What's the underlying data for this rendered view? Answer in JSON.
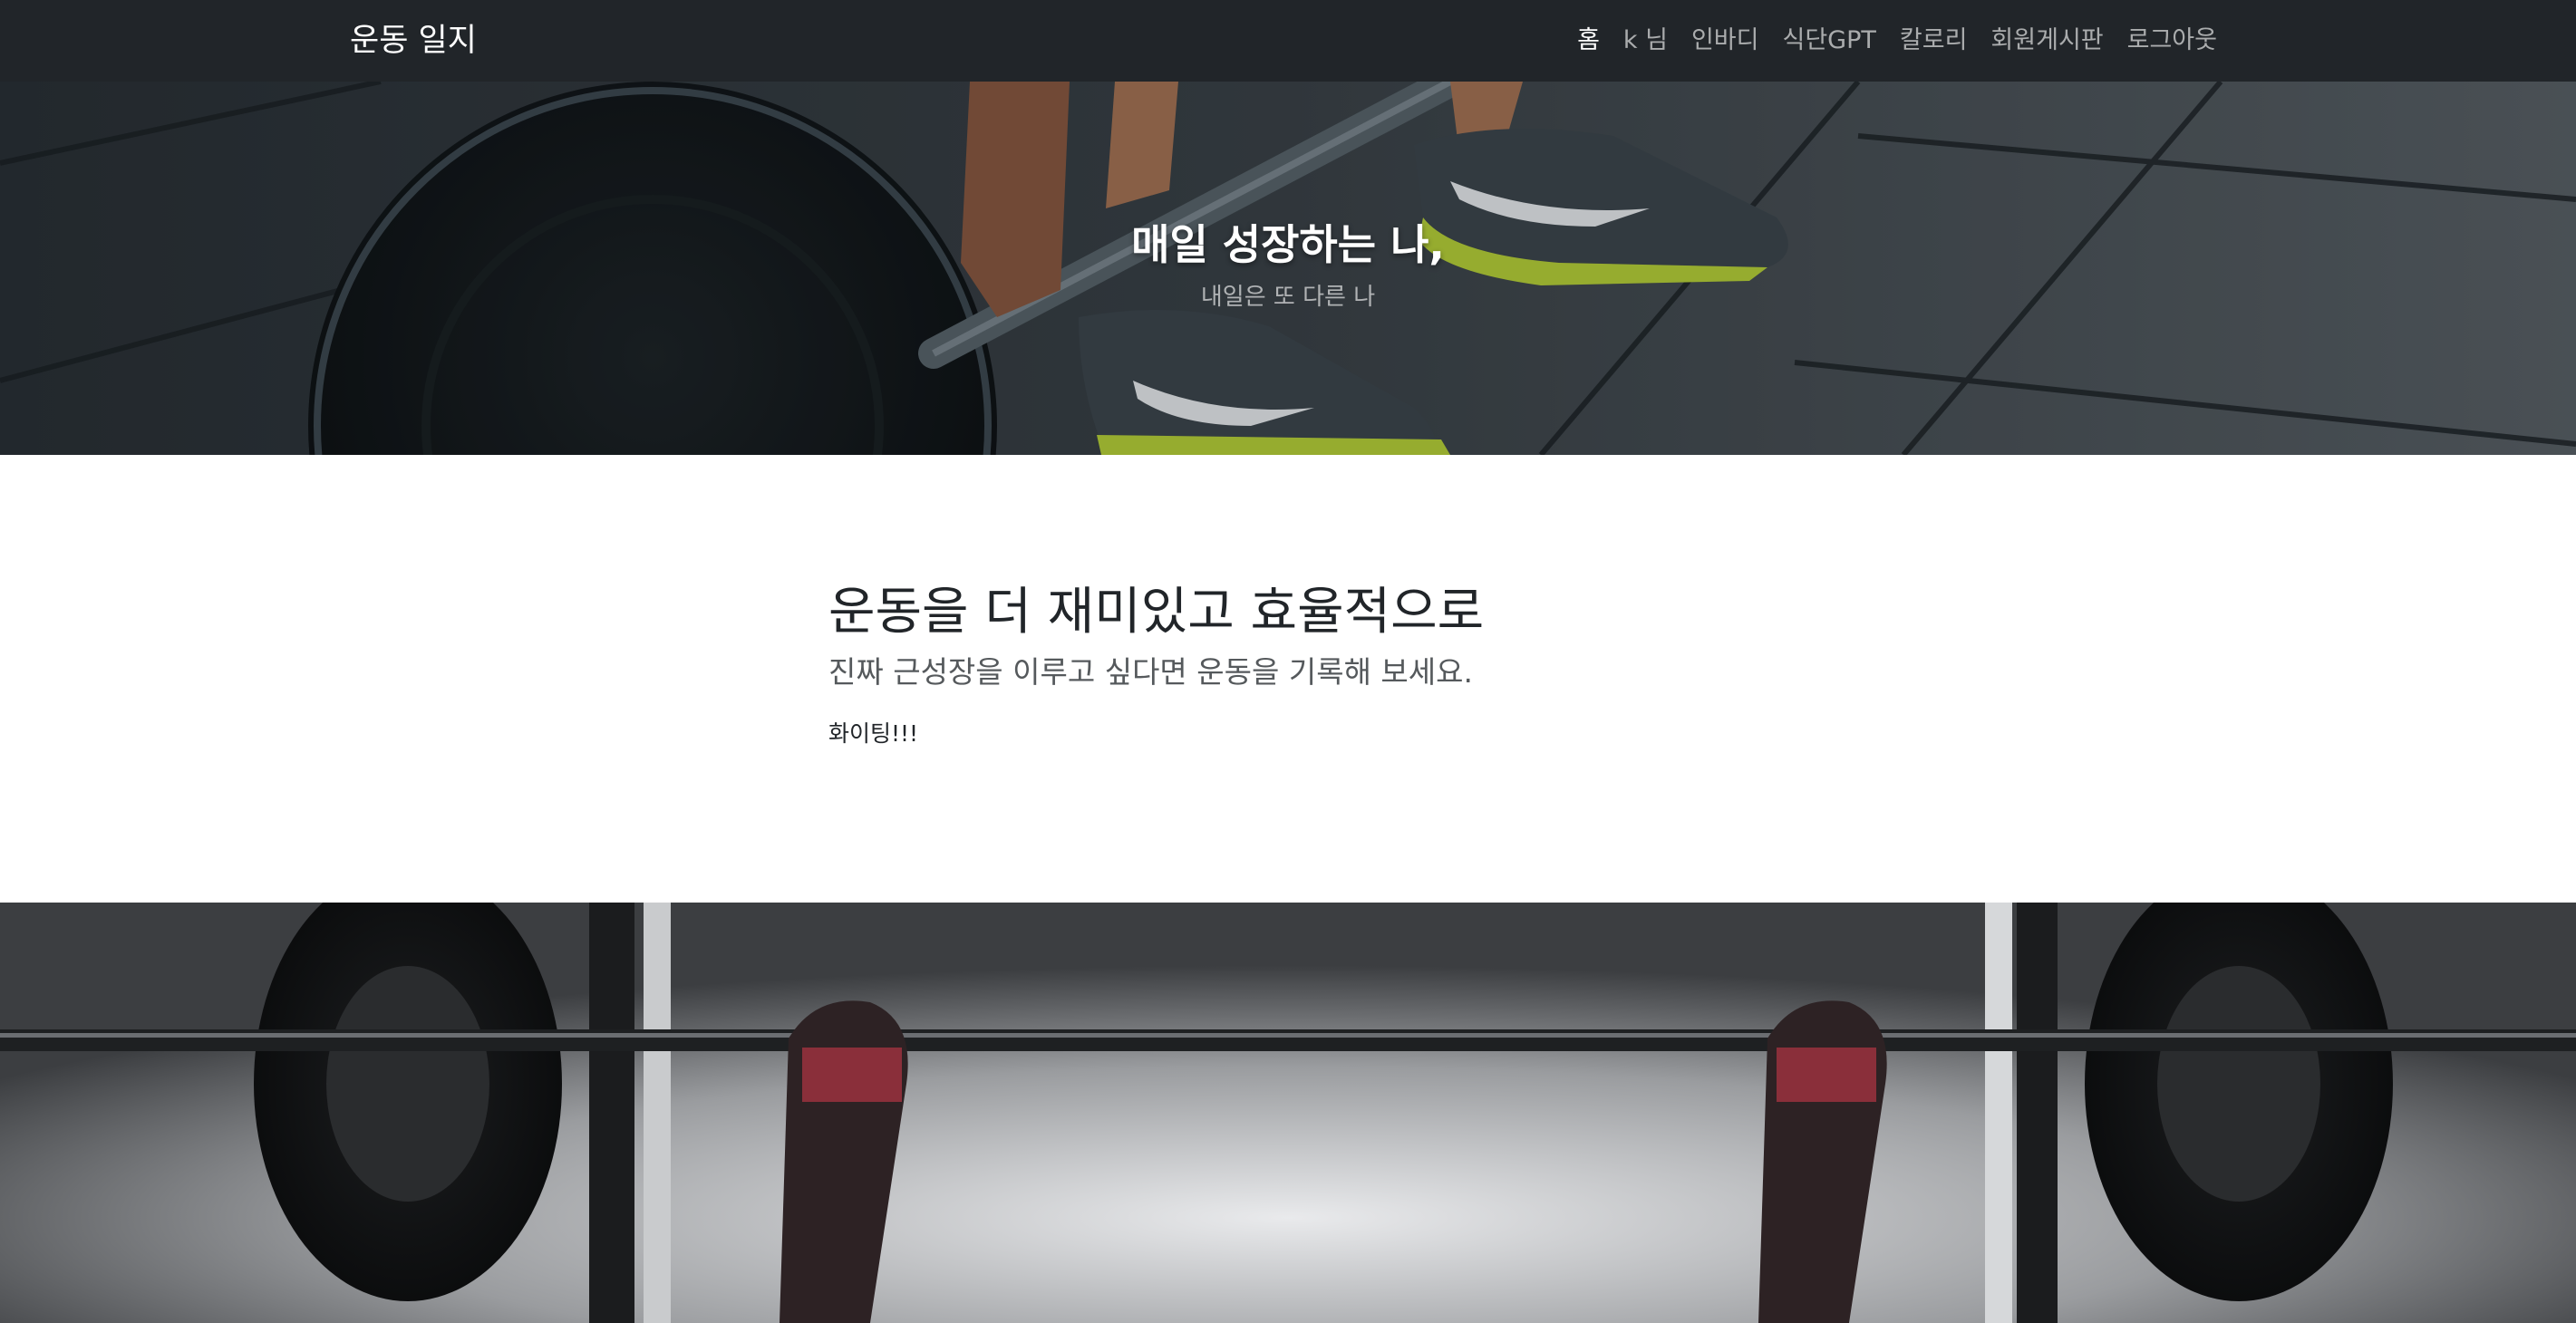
{
  "navbar": {
    "brand": "운동 일지",
    "items": [
      {
        "label": "홈",
        "active": true
      },
      {
        "label": "k 님",
        "active": false
      },
      {
        "label": "인바디",
        "active": false
      },
      {
        "label": "식단GPT",
        "active": false
      },
      {
        "label": "칼로리",
        "active": false
      },
      {
        "label": "회원게시판",
        "active": false
      },
      {
        "label": "로그아웃",
        "active": false
      }
    ]
  },
  "hero": {
    "title": "매일 성장하는 나,",
    "subtitle": "내일은 또 다른 나"
  },
  "intro": {
    "heading": "운동을 더 재미있고 효율적으로",
    "lead": "진짜 근성장을 이루고 싶다면 운동을 기록해 보세요.",
    "note": "화이팅!!!"
  },
  "colors": {
    "navbar_bg": "#212529",
    "shoe_accent": "#b8d23a",
    "text_dark": "#212529"
  }
}
